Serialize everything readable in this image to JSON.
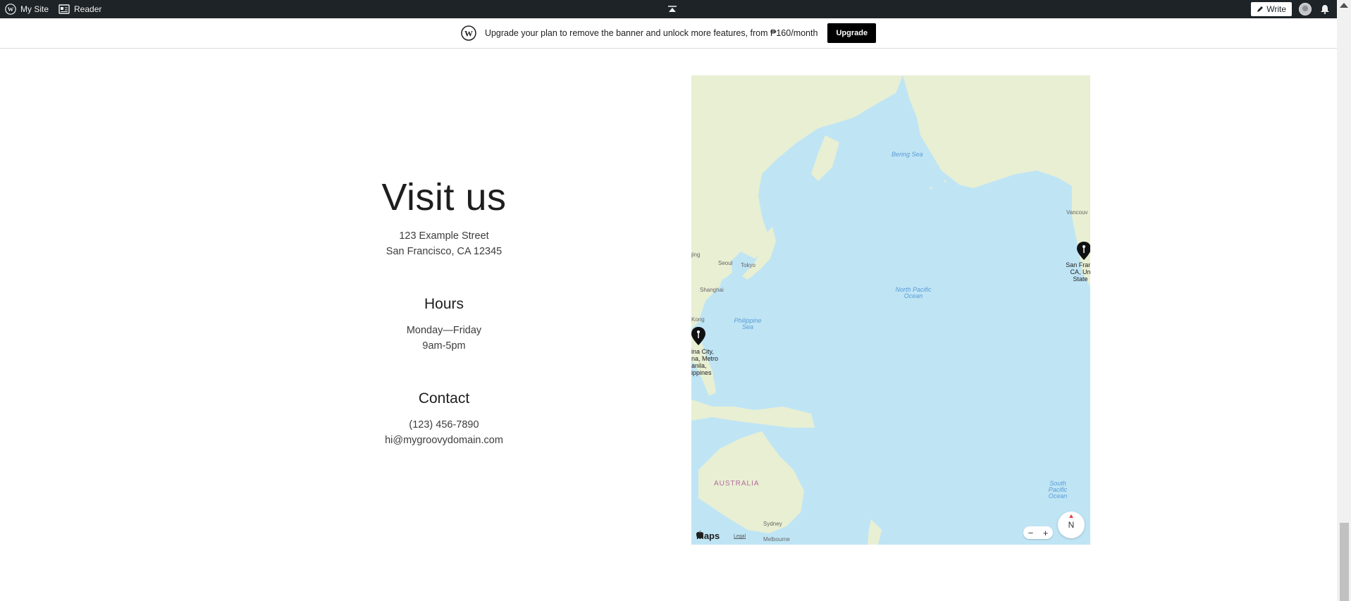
{
  "adminbar": {
    "my_site": "My Site",
    "reader": "Reader",
    "write": "Write",
    "icons": [
      "wordpress-icon",
      "reader-icon",
      "collapse-icon",
      "pen-icon",
      "avatar",
      "bell-icon"
    ]
  },
  "banner": {
    "message": "Upgrade your plan to remove the banner and unlock more features, from ₱160/month",
    "button": "Upgrade"
  },
  "info": {
    "title": "Visit us",
    "address_line1": "123 Example Street",
    "address_line2": "San Francisco, CA 12345",
    "hours_heading": "Hours",
    "hours_days": "Monday—Friday",
    "hours_time": "9am-5pm",
    "contact_heading": "Contact",
    "phone": "(123) 456-7890",
    "email": "hi@mygroovydomain.com"
  },
  "map": {
    "labels": {
      "bering_sea": "Bering Sea",
      "north_pacific": "North Pacific Ocean",
      "south_pacific": "South Pacific Ocean",
      "philippine_sea": "Philippine Sea",
      "australia": "AUSTRALIA",
      "seoul": "Seoul",
      "tokyo": "Tokyo",
      "shanghai": "Shanghai",
      "beijing": "jing",
      "hong_kong": "Kong",
      "vancouver": "Vancouv",
      "sydney": "Sydney",
      "melbourne": "Melbourne"
    },
    "pin_sf": "San Franc CA, Un State",
    "pin_manila": "ina City, na, Metro anila, ippines",
    "maps_brand": "Maps",
    "legal": "Legal",
    "zoom_out": "−",
    "zoom_in": "+",
    "compass": "N"
  },
  "colors": {
    "adminbar": "#1d2327",
    "ocean": "#bfe5f5",
    "land": "#e9efd3",
    "accent_black": "#000000"
  }
}
